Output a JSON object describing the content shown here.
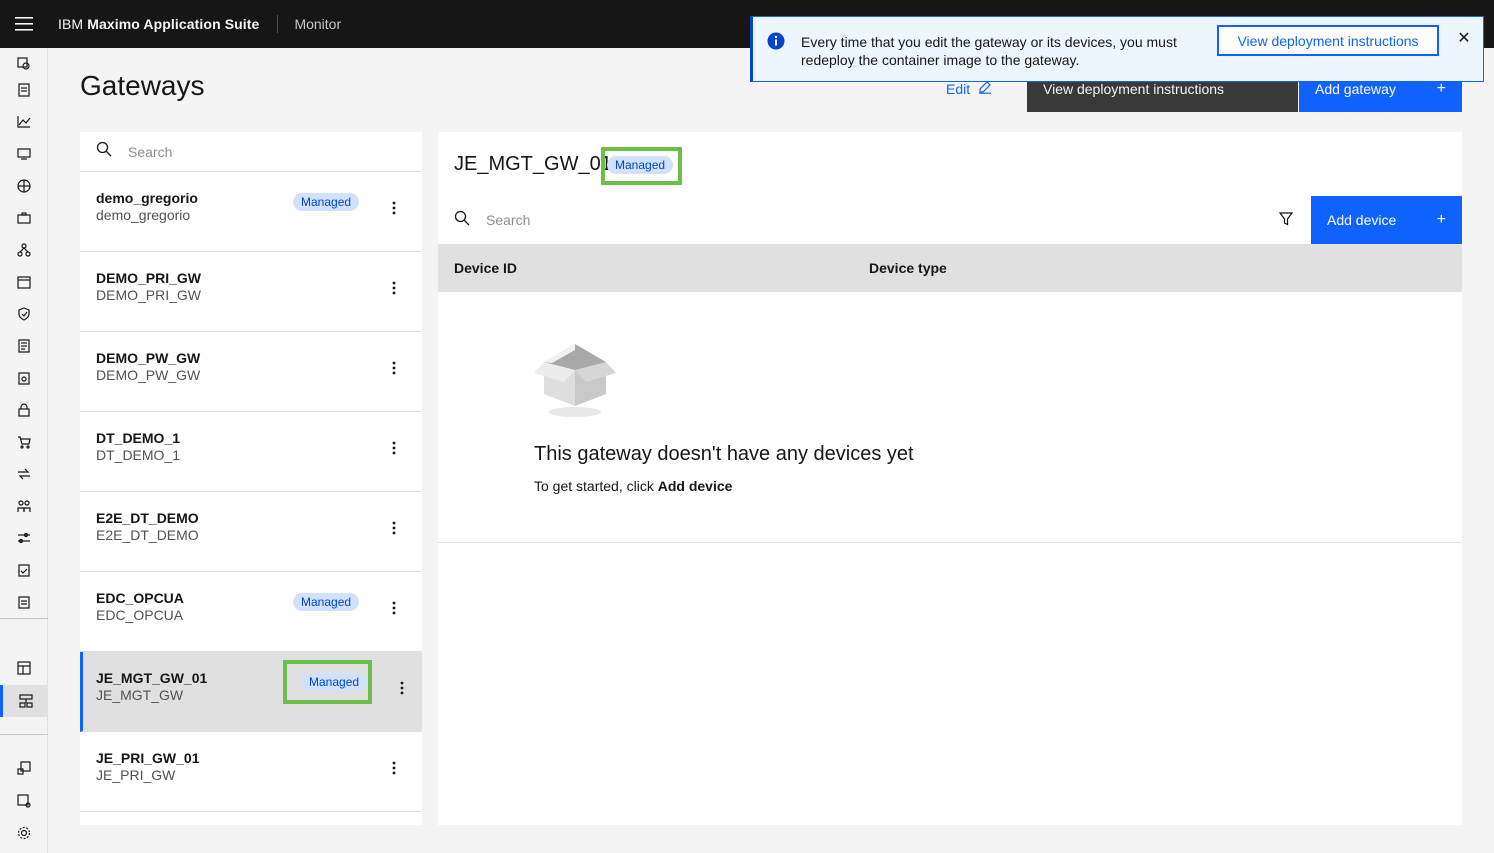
{
  "header": {
    "brand_prefix": "IBM",
    "brand_name": "Maximo Application Suite",
    "app_name": "Monitor"
  },
  "notification": {
    "message": "Every time that you edit the gateway or its devices, you must redeploy the container image to the gateway.",
    "action_label": "View deployment instructions",
    "close_glyph": "✕"
  },
  "page": {
    "title": "Gateways",
    "edit_label": "Edit",
    "view_instructions_label": "View deployment instructions",
    "add_gateway_label": "Add gateway",
    "plus_glyph": "+"
  },
  "gateway_list": {
    "search_placeholder": "Search",
    "items": [
      {
        "name": "demo_gregorio",
        "sub": "demo_gregorio",
        "tag": "Managed"
      },
      {
        "name": "DEMO_PRI_GW",
        "sub": "DEMO_PRI_GW",
        "tag": ""
      },
      {
        "name": "DEMO_PW_GW",
        "sub": "DEMO_PW_GW",
        "tag": ""
      },
      {
        "name": "DT_DEMO_1",
        "sub": "DT_DEMO_1",
        "tag": ""
      },
      {
        "name": "E2E_DT_DEMO",
        "sub": "E2E_DT_DEMO",
        "tag": ""
      },
      {
        "name": "EDC_OPCUA",
        "sub": "EDC_OPCUA",
        "tag": "Managed"
      },
      {
        "name": "JE_MGT_GW_01",
        "sub": "JE_MGT_GW",
        "tag": "Managed"
      },
      {
        "name": "JE_PRI_GW_01",
        "sub": "JE_PRI_GW",
        "tag": ""
      }
    ]
  },
  "detail": {
    "title": "JE_MGT_GW_01",
    "tag": "Managed",
    "search_placeholder": "Search",
    "add_device_label": "Add device",
    "columns": [
      "Device ID",
      "Device type"
    ],
    "empty_title": "This gateway doesn't have any devices yet",
    "empty_sub_prefix": "To get started, click ",
    "empty_sub_action": "Add device"
  },
  "colors": {
    "primary": "#0f62fe",
    "header_bg": "#161616",
    "tag_bg": "#d0e2ff",
    "highlight": "#6cc04a"
  }
}
